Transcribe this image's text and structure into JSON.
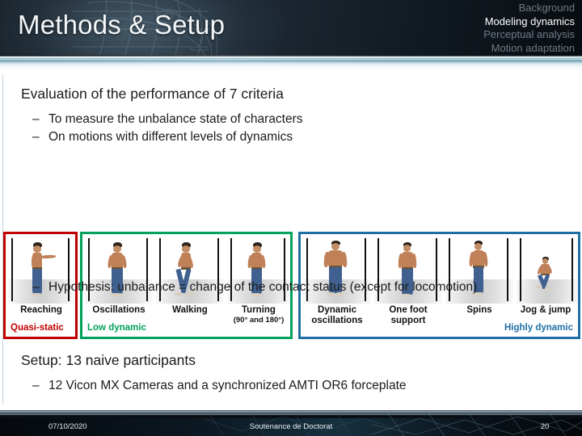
{
  "header": {
    "title": "Methods & Setup",
    "nav": [
      {
        "label": "Background",
        "active": false
      },
      {
        "label": "Modeling dynamics",
        "active": true
      },
      {
        "label": "Perceptual analysis",
        "active": false
      },
      {
        "label": "Motion adaptation",
        "active": false
      }
    ]
  },
  "body": {
    "heading1": "Evaluation of the performance of 7 criteria",
    "bullet1": "To measure the unbalance state of characters",
    "bullet2": "On motions with different levels of dynamics",
    "bullet3": "Hypothesis: unbalance = change of the contact status (except for locomotion)",
    "heading2": "Setup: 13 naive participants",
    "bullet4": "12 Vicon MX Cameras and a synchronized AMTI OR6 forceplate",
    "dash": "–"
  },
  "strip": {
    "groups": [
      {
        "tag": "Quasi-static",
        "color": "#c00000",
        "cells": [
          {
            "caption": "Reaching",
            "sub": ""
          }
        ]
      },
      {
        "tag": "Low dynamic",
        "color": "#00a15a",
        "cells": [
          {
            "caption": "Oscillations",
            "sub": ""
          },
          {
            "caption": "Walking",
            "sub": ""
          },
          {
            "caption": "Turning",
            "sub": "(90° and 180°)"
          }
        ]
      },
      {
        "tag": "Highly dynamic",
        "color": "#1f6fa5",
        "cells": [
          {
            "caption": "Dynamic",
            "sub": "oscillations"
          },
          {
            "caption": "One foot",
            "sub": "support"
          },
          {
            "caption": "Spins",
            "sub": ""
          },
          {
            "caption": "Jog & jump",
            "sub": ""
          }
        ]
      }
    ]
  },
  "footer": {
    "date": "07/10/2020",
    "center": "Soutenance de Doctorat",
    "page": "20"
  },
  "colors": {
    "quasi_static": "#c00000",
    "low_dynamic": "#00a15a",
    "highly_dynamic": "#1f6fa5",
    "nav_active": "#ffffff",
    "nav_inactive": "#6e7b86"
  }
}
